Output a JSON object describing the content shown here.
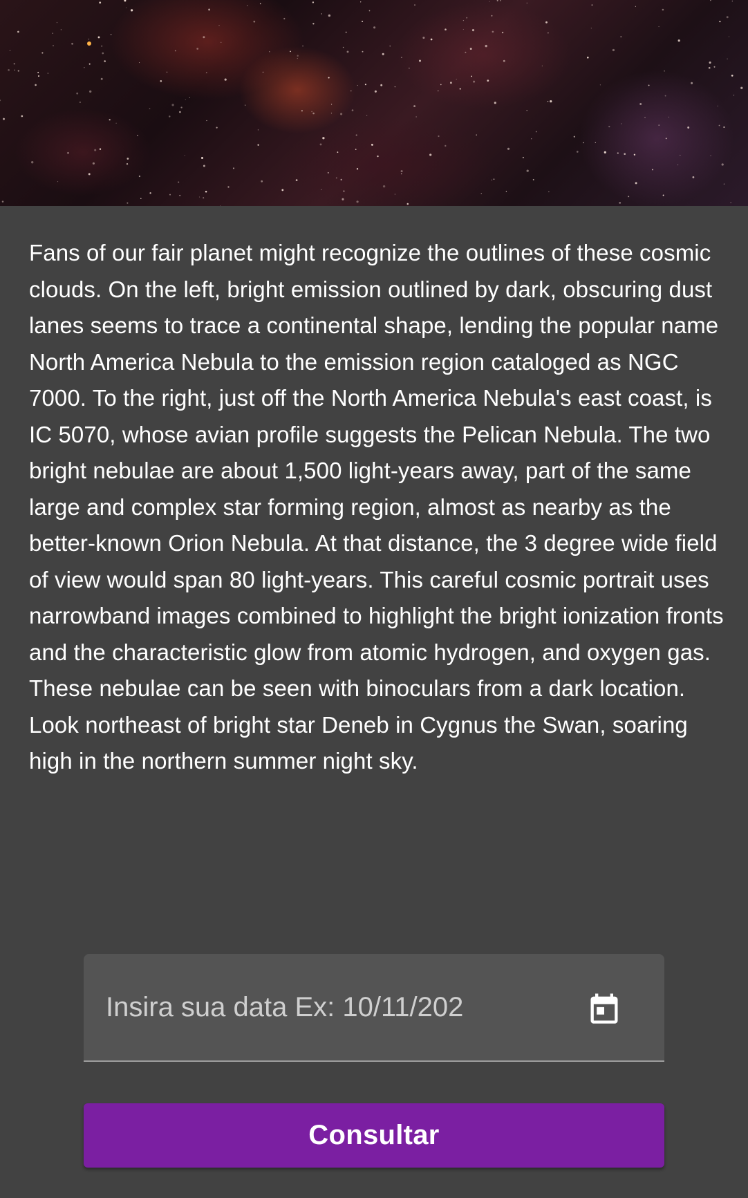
{
  "hero": {
    "alt": "Nebula image"
  },
  "description": {
    "text": "Fans of our fair planet might recognize the outlines of these cosmic clouds. On the left, bright emission outlined by dark, obscuring dust lanes seems to trace a continental shape, lending the popular name North America Nebula to the emission region cataloged as NGC 7000. To the right, just off the North America Nebula's east coast, is IC 5070, whose avian profile suggests the Pelican Nebula. The two bright nebulae are about 1,500 light-years away, part of the same large and complex star forming region, almost as nearby as the better-known Orion Nebula. At that distance, the 3 degree wide field of view would span 80 light-years. This careful cosmic portrait uses narrowband images combined to highlight the bright ionization fronts and the characteristic glow from atomic hydrogen, and oxygen gas. These nebulae can be seen with binoculars from a dark location. Look northeast of bright star Deneb in Cygnus the Swan, soaring high in the northern summer night sky."
  },
  "date_field": {
    "value": "",
    "placeholder": "Insira sua data Ex: 10/11/202",
    "icon": "calendar-icon"
  },
  "submit": {
    "label": "Consultar",
    "color": "#7b1fa2"
  },
  "theme": {
    "background": "#424242",
    "field_background": "#545454"
  }
}
